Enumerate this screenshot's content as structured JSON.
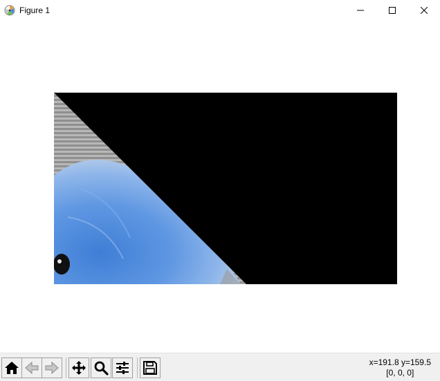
{
  "window": {
    "title": "Figure 1"
  },
  "titlebar": {
    "app_icon": "matplotlib-logo-icon",
    "controls": [
      "minimize-icon",
      "maximize-icon",
      "close-icon"
    ]
  },
  "toolbar": {
    "buttons": [
      {
        "name": "home-button",
        "icon": "home-icon"
      },
      {
        "name": "back-button",
        "icon": "back-arrow-icon"
      },
      {
        "name": "forward-button",
        "icon": "forward-arrow-icon"
      },
      {
        "name": "pan-button",
        "icon": "move-icon"
      },
      {
        "name": "zoom-button",
        "icon": "magnifier-icon"
      },
      {
        "name": "configure-subplots-button",
        "icon": "sliders-icon"
      },
      {
        "name": "save-button",
        "icon": "floppy-disk-icon"
      }
    ]
  },
  "status": {
    "coordinates": "x=191.8 y=159.5",
    "pixel_value": "[0, 0, 0]"
  },
  "figure": {
    "background_color": "#ffffff",
    "image_fill_color": "#000000"
  }
}
